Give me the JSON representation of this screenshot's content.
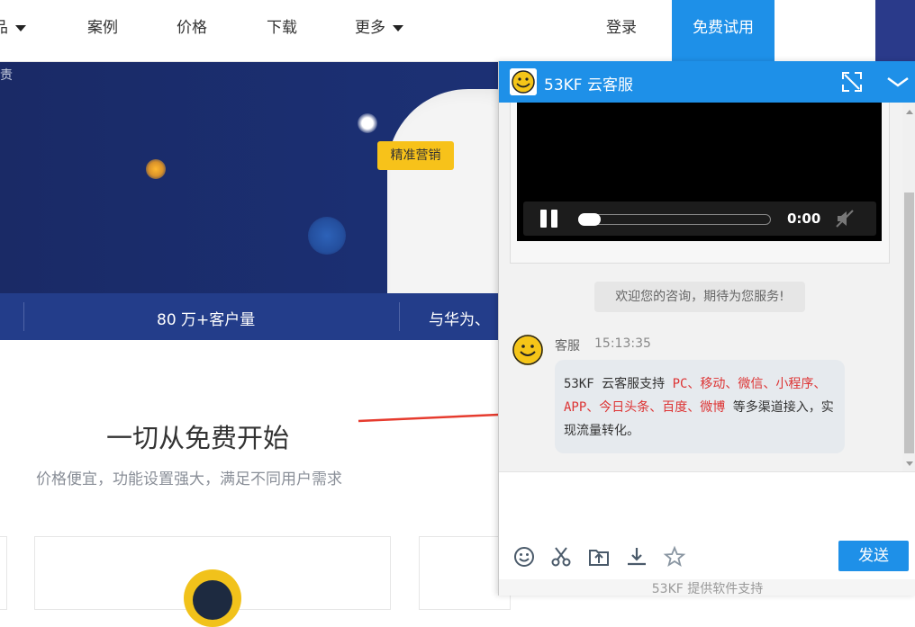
{
  "nav": {
    "partial_item": "品",
    "items": [
      "案例",
      "价格",
      "下载",
      "更多"
    ],
    "login": "登录",
    "trial": "免费试用"
  },
  "banner": {
    "ghost_text": "责",
    "tag": "精准营销",
    "stats": [
      "80 万+客户量",
      "与华为、"
    ]
  },
  "section": {
    "title": "一切从免费开始",
    "subtitle": "价格便宜，功能设置强大，满足不同用户需求"
  },
  "chat": {
    "title": "53KF 云客服",
    "video_time": "0:00",
    "welcome": "欢迎您的咨询，期待为您服务!",
    "agent_name": "客服",
    "agent_time": "15:13:35",
    "message": {
      "prefix": "53KF 云客服支持 ",
      "channels": "PC、移动、微信、小程序、APP、今日头条、百度、微博",
      "suffix": " 等多渠道接入，实现流量转化。"
    },
    "send": "发送",
    "credit": "53KF 提供软件支持"
  },
  "colors": {
    "primary": "#1e90e8",
    "banner_dark": "#1b2f72",
    "stats_bar": "#233d8a",
    "tag_yellow": "#f7c21a",
    "highlight_red": "#dd3333"
  },
  "icons": [
    "chevron-down-icon",
    "expand-icon",
    "collapse-icon",
    "smiley-logo-icon",
    "pause-icon",
    "mute-icon",
    "emoji-icon",
    "scissors-icon",
    "upload-icon",
    "download-icon",
    "star-icon"
  ]
}
